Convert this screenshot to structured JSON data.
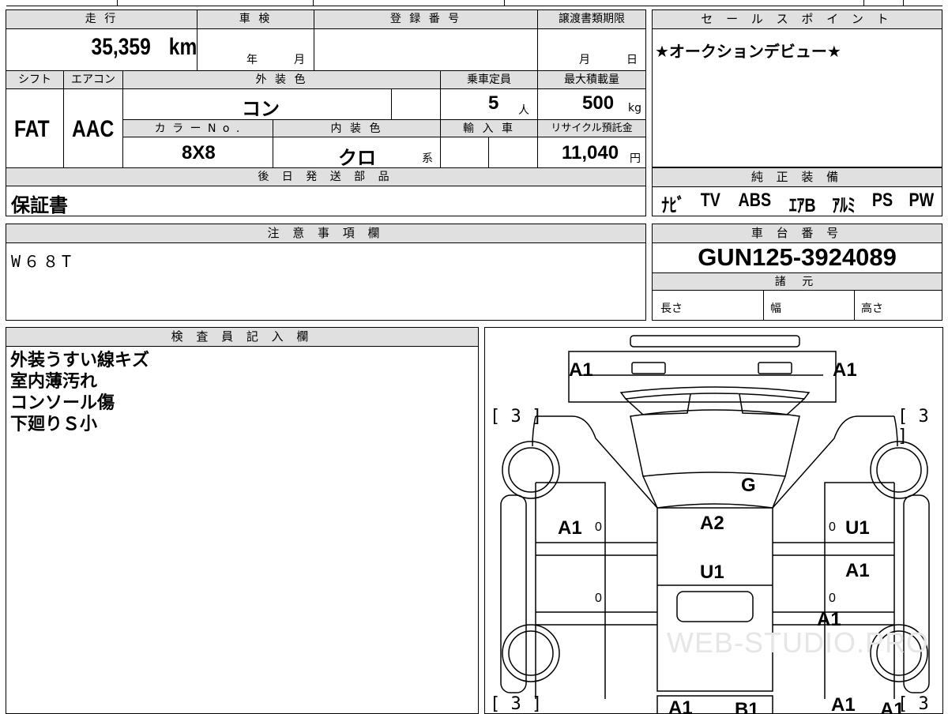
{
  "header_row": {
    "mileage_label": "走 行",
    "inspection_label": "車 検",
    "registration_label": "登 録 番 号",
    "transfer_deadline_label": "譲渡書類期限",
    "mileage_value": "35,359",
    "mileage_unit": "km",
    "inspection_year": "年",
    "inspection_month": "月",
    "transfer_month": "月",
    "transfer_day": "日"
  },
  "specs": {
    "shift_label": "シフト",
    "aircon_label": "エアコン",
    "exterior_color_label": "外 装 色",
    "capacity_label": "乗車定員",
    "max_load_label": "最大積載量",
    "shift_value": "FAT",
    "aircon_value": "AAC",
    "exterior_color_value": "コン",
    "capacity_value": "5",
    "capacity_unit": "人",
    "max_load_value": "500",
    "max_load_unit": "kg",
    "color_no_label": "カ ラ ー N o .",
    "interior_color_label": "内 装 色",
    "import_label": "輸 入 車",
    "recycle_label": "リサイクル預託金",
    "color_no_value": "8X8",
    "interior_color_value": "クロ",
    "interior_color_suffix": "系",
    "recycle_value": "11,040",
    "recycle_unit": "円"
  },
  "shipping": {
    "label": "後 日 発 送 部 品",
    "value": "保証書"
  },
  "sales_point": {
    "label": "セ ー ル ス ポ イ ン ト",
    "value": "★オークションデビュー★"
  },
  "genuine_equipment": {
    "label": "純 正 装 備",
    "items": [
      "ﾅﾋﾞ",
      "TV",
      "ABS",
      "ｴｱB",
      "ｱﾙﾐ",
      "PS",
      "PW"
    ]
  },
  "notes": {
    "label": "注 意 事 項 欄",
    "value": "W６８T"
  },
  "chassis": {
    "label": "車 台 番 号",
    "value": "GUN125-3924089",
    "spec_label": "諸 元",
    "length_label": "長さ",
    "width_label": "幅",
    "height_label": "高さ"
  },
  "inspector": {
    "label": "検 査 員 記 入 欄",
    "lines": [
      "外装うすい線キズ",
      "室内薄汚れ",
      "コンソール傷",
      "下廻りＳ小"
    ]
  },
  "diagram": {
    "marks": [
      "A1",
      "A1",
      "A1",
      "G",
      "A2",
      "U1",
      "U1",
      "A1",
      "A1",
      "A1",
      "A1",
      "A1",
      "B1"
    ],
    "brackets": [
      "[ 3 ]",
      "[ 3 ]",
      "[ 3 ]",
      "[ 3 ]"
    ],
    "zero": "0",
    "watermark": "WEB-STUDIO.PRO"
  }
}
